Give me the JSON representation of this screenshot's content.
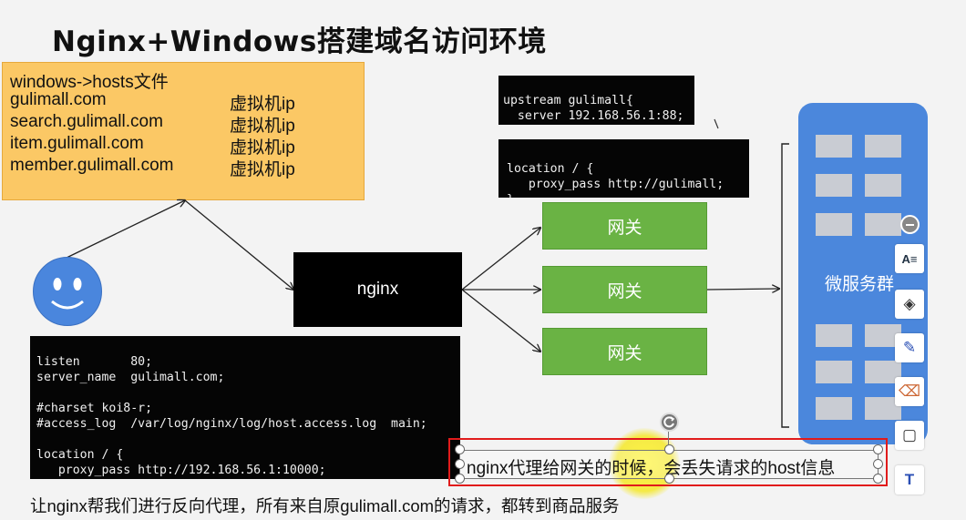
{
  "slide": {
    "title": "Nginx+Windows搭建域名访问环境"
  },
  "hosts_box": {
    "header": "windows->hosts文件",
    "entries": [
      {
        "domain": "gulimall.com",
        "ip": "虚拟机ip"
      },
      {
        "domain": "search.gulimall.com",
        "ip": "虚拟机ip"
      },
      {
        "domain": "item.gulimall.com",
        "ip": "虚拟机ip"
      },
      {
        "domain": "member.gulimall.com",
        "ip": "虚拟机ip"
      }
    ]
  },
  "upstream_code": {
    "lines": [
      "upstream gulimall{",
      "  server 192.168.56.1:88;",
      "}"
    ]
  },
  "location_code": {
    "lines": [
      "location / {",
      "   proxy_pass http://gulimall;",
      "}"
    ]
  },
  "server_code": {
    "lines": [
      "listen       80;",
      "server_name  gulimall.com;",
      "",
      "#charset koi8-r;",
      "#access_log  /var/log/nginx/log/host.access.log  main;",
      "",
      "location / {",
      "   proxy_pass http://192.168.56.1:10000;",
      "}"
    ]
  },
  "nginx_node": {
    "label": "nginx"
  },
  "gateways": [
    {
      "label": "网关"
    },
    {
      "label": "网关"
    },
    {
      "label": "网关"
    }
  ],
  "microservices": {
    "label": "微服务群"
  },
  "callout": {
    "text": "nginx代理给网关的时候，会丢失请求的host信息"
  },
  "footer": {
    "text": "让nginx帮我们进行反向代理，所有来自原gulimall.com的请求，都转到商品服务"
  },
  "toolbar": {
    "buttons": [
      {
        "icon": "text-recognition-icon",
        "glyph": "A≡"
      },
      {
        "icon": "layers-icon",
        "glyph": "◈"
      },
      {
        "icon": "pen-icon",
        "glyph": "✎"
      },
      {
        "icon": "eraser-icon",
        "glyph": "⌫"
      },
      {
        "icon": "frame-icon",
        "glyph": "▢"
      },
      {
        "icon": "text-box-icon",
        "glyph": "T"
      }
    ]
  },
  "colors": {
    "hosts_bg": "#fbc865",
    "gateway_green": "#6ab344",
    "microservice_blue": "#4b87dc",
    "callout_red": "#e11b1b"
  }
}
